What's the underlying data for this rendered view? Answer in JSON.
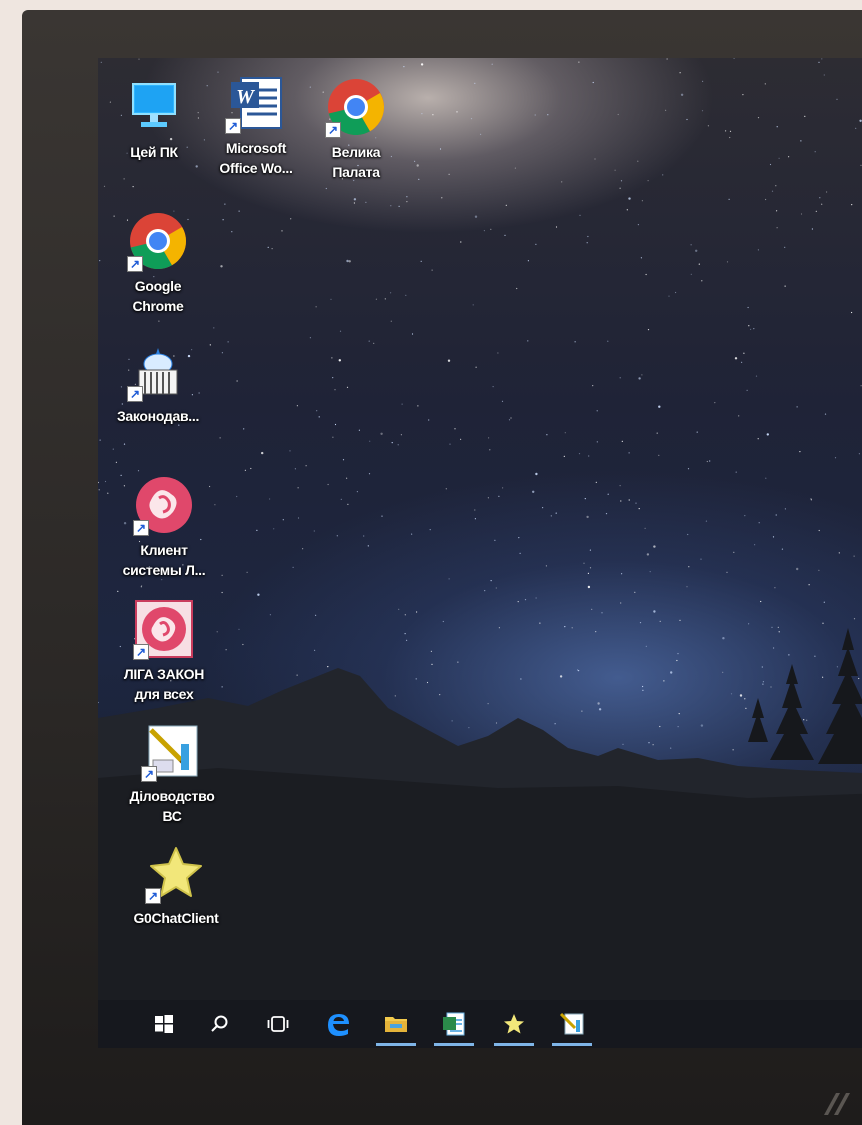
{
  "desktop": {
    "icons": [
      {
        "label": "Цей ПК",
        "icon": "this-pc-icon"
      },
      {
        "label": "Microsoft Office Wo...",
        "icon": "word-icon"
      },
      {
        "label": "Велика Палата",
        "icon": "chrome-icon"
      },
      {
        "label": "Google Chrome",
        "icon": "chrome-icon"
      },
      {
        "label": "Законодав...",
        "icon": "parliament-icon"
      },
      {
        "label": "Клиент системы Л...",
        "icon": "liga-client-icon"
      },
      {
        "label": "ЛІГА ЗАКОН для всех",
        "icon": "liga-zakon-icon"
      },
      {
        "label": "Діловодство ВС",
        "icon": "document-flow-icon"
      },
      {
        "label": "G0ChatClient",
        "icon": "star-chat-icon"
      }
    ]
  },
  "taskbar": {
    "items": [
      {
        "name": "start-button",
        "icon": "windows-icon"
      },
      {
        "name": "search-button",
        "icon": "search-icon"
      },
      {
        "name": "task-view-button",
        "icon": "task-view-icon"
      },
      {
        "name": "edge-button",
        "icon": "edge-icon"
      },
      {
        "name": "file-explorer-button",
        "icon": "folder-icon",
        "active": true
      },
      {
        "name": "word-taskbar-button",
        "icon": "word-doc-icon",
        "active": true
      },
      {
        "name": "chat-taskbar-button",
        "icon": "star-chat-icon",
        "active": true
      },
      {
        "name": "document-flow-taskbar-button",
        "icon": "document-flow-icon",
        "active": true
      }
    ]
  },
  "colors": {
    "taskbar_active_underline": "#7fb5e8",
    "edge_blue": "#1e90ff",
    "word_blue": "#2b5797"
  }
}
